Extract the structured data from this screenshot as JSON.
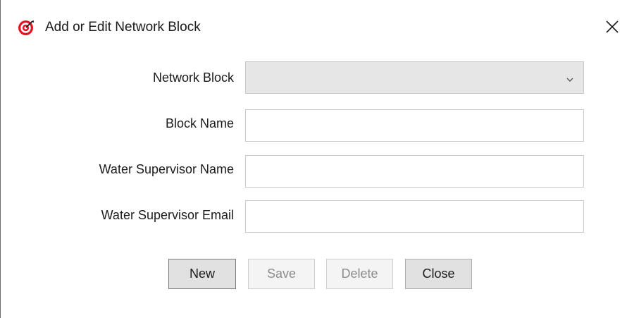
{
  "window": {
    "title": "Add or Edit Network Block",
    "icon": "target-icon",
    "close_icon": "close-icon",
    "accent_color": "#e81123"
  },
  "form": {
    "network_block": {
      "label": "Network Block",
      "value": ""
    },
    "block_name": {
      "label": "Block Name",
      "value": ""
    },
    "supervisor_name": {
      "label": "Water Supervisor Name",
      "value": ""
    },
    "supervisor_email": {
      "label": "Water Supervisor Email",
      "value": ""
    }
  },
  "buttons": {
    "new": {
      "label": "New",
      "enabled": true
    },
    "save": {
      "label": "Save",
      "enabled": false
    },
    "delete": {
      "label": "Delete",
      "enabled": false
    },
    "close": {
      "label": "Close",
      "enabled": true
    }
  }
}
